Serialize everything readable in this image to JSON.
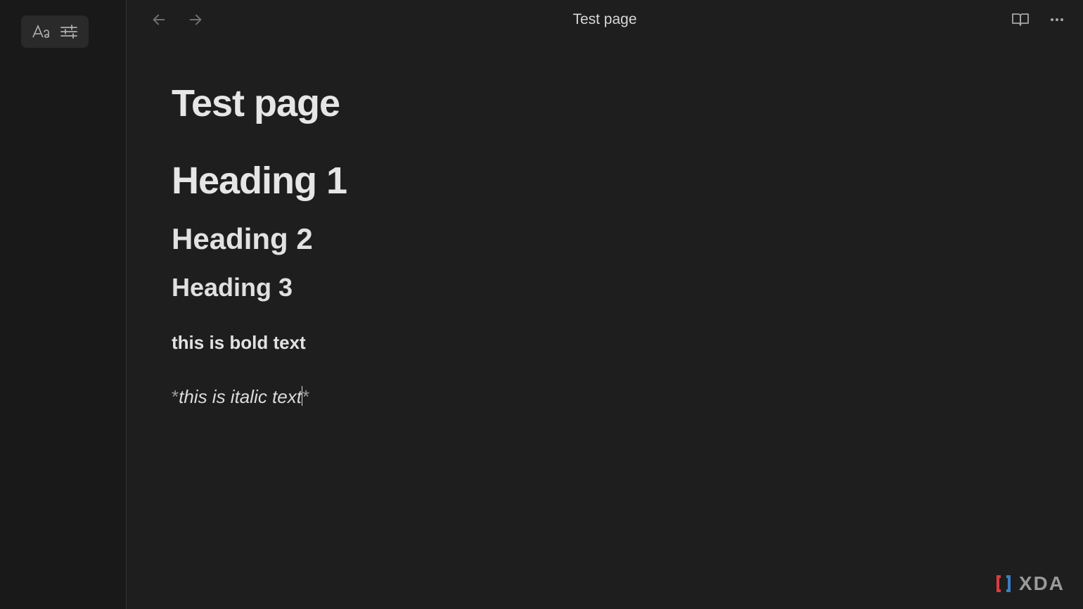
{
  "header": {
    "title": "Test page"
  },
  "document": {
    "page_title": "Test page",
    "heading_1": "Heading 1",
    "heading_2": "Heading 2",
    "heading_3": "Heading 3",
    "bold_text": "this is bold text",
    "italic_raw_prefix": "*",
    "italic_text": "this is italic text",
    "italic_raw_suffix": "*"
  },
  "watermark": {
    "text": "XDA"
  }
}
